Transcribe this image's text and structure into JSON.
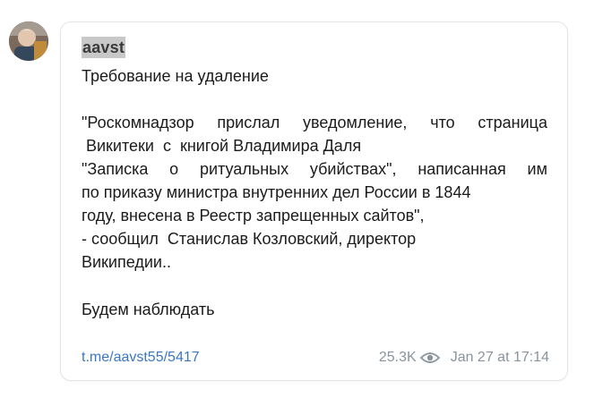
{
  "channel": {
    "author": "aavst",
    "avatar": "avatar"
  },
  "post": {
    "title": "Требование на удаление",
    "quote_lines": [
      "\"Роскомнадзор прислал уведомление, что страница",
      " Викитеки  с  книгой Владимира Даля",
      "\"Записка  о  ритуальных  убийствах\",  написанная  им",
      "по приказу министра внутренних дел России в 1844",
      "году, внесена в Реестр запрещенных сайтов\",",
      "- сообщил  Станислав Козловский, директор",
      "Википедии.."
    ],
    "closing": "Будем наблюдать"
  },
  "footer": {
    "link": "t.me/aavst55/5417",
    "views": "25.3K",
    "views_icon": "eye-icon",
    "date": "Jan 27 at 17:14"
  },
  "colors": {
    "link": "#3b76c3",
    "meta": "#8a949e",
    "author_highlight": "#c8c8c8"
  }
}
